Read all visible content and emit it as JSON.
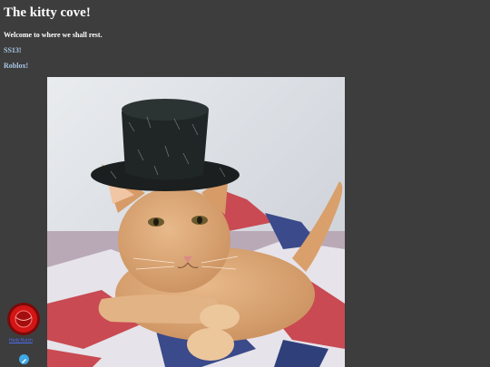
{
  "page": {
    "title": "The kitty cove!",
    "welcome": "Welcome to where we shall rest."
  },
  "links": {
    "ss13": "SS13!",
    "roblox": "Roblox!"
  },
  "badge": {
    "caption": "Hedy Butch",
    "icon": "red-button-icon"
  },
  "edit": {
    "icon": "pencil-icon"
  },
  "photo": {
    "subject": "cat-in-hat-photo"
  },
  "colors": {
    "background": "#3d3d3d",
    "link": "#a9c7e6",
    "title": "#ffffff"
  }
}
